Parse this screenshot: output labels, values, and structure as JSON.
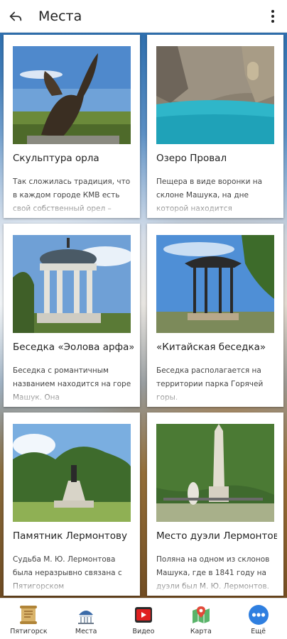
{
  "appbar": {
    "title": "Места",
    "back_icon": "back-arrow-icon",
    "more_icon": "more-vertical-icon"
  },
  "places": [
    {
      "title": "Скульптура орла",
      "description": "Так сложилась традиция, что в каждом городе КМВ есть свой собственный орел – символ",
      "image": "eagle-sculpture"
    },
    {
      "title": "Озеро Провал",
      "description": "Пещера в виде воронки на склоне Машука, на дне которой находится",
      "image": "proval-lake"
    },
    {
      "title": "Беседка «Эолова арфа»",
      "description": "Беседка с романтичным названием находится на горе Машук. Она",
      "image": "aeolian-harp"
    },
    {
      "title": "«Китайская беседка»",
      "description": "Беседка располагается на территории парка Горячей горы.",
      "image": "chinese-gazebo"
    },
    {
      "title": "Памятник Лермонтову",
      "description": "Судьба М. Ю. Лермонтова была неразрывно связана с Пятигорском",
      "image": "lermontov-monument"
    },
    {
      "title": "Место дуэли Лермонтова",
      "description": "Поляна на одном из склонов Машука, где в 1841 году на дуэли был М. Ю. Лермонтов. Обелиск",
      "image": "duel-site"
    }
  ],
  "bottom_nav": [
    {
      "label": "Пятигорск",
      "icon": "scroll-icon"
    },
    {
      "label": "Места",
      "icon": "landmark-icon"
    },
    {
      "label": "Видео",
      "icon": "video-icon"
    },
    {
      "label": "Карта",
      "icon": "map-pin-icon"
    },
    {
      "label": "Ещё",
      "icon": "more-circle-icon"
    }
  ],
  "colors": {
    "accent": "#2f7fe0",
    "video_red": "#e02020"
  }
}
